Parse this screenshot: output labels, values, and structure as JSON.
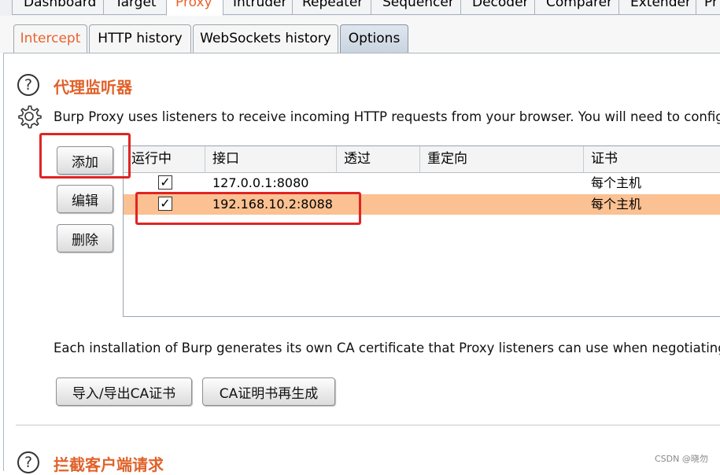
{
  "top_tabs": [
    "Dashboard",
    "Target",
    "Proxy",
    "Intruder",
    "Repeater",
    "Sequencer",
    "Decoder",
    "Comparer",
    "Extender",
    "Pr"
  ],
  "sub_tabs": [
    "Intercept",
    "HTTP history",
    "WebSockets history",
    "Options"
  ],
  "listeners": {
    "heading": "代理监听器",
    "description": "Burp Proxy uses listeners to receive incoming HTTP requests from your browser. You will need to configure",
    "buttons": {
      "add": "添加",
      "edit": "编辑",
      "remove": "删除"
    },
    "columns": [
      "运行中",
      "接口",
      "透过",
      "重定向",
      "证书"
    ],
    "rows": [
      {
        "running": "✓",
        "interface": "127.0.0.1:8080",
        "invisible": "",
        "redirect": "",
        "certificate": "每个主机"
      },
      {
        "running": "✓",
        "interface": "192.168.10.2:8088",
        "invisible": "",
        "redirect": "",
        "certificate": "每个主机"
      }
    ]
  },
  "ca": {
    "description": "Each installation of Burp generates its own CA certificate that Proxy listeners can use when negotiating TLS",
    "import_export_label": "导入/导出CA证书",
    "regenerate_label": "CA证明书再生成"
  },
  "intercept_requests": {
    "heading": "拦截客户端请求"
  },
  "watermark": "CSDN @晓勿",
  "colors": {
    "accent": "#e8632c",
    "selected_row": "#fbc192",
    "annotation": "#e02424"
  }
}
